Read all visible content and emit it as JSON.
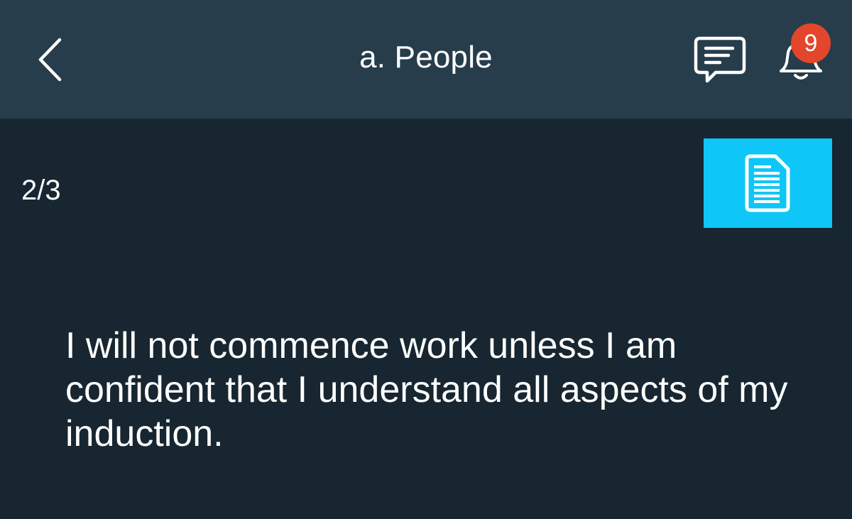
{
  "header": {
    "title": "a. People",
    "back_icon": "chevron-left-icon",
    "chat_icon": "chat-bubble-icon",
    "notification_icon": "bell-icon",
    "notification_count": "9"
  },
  "main": {
    "counter": "2/3",
    "document_icon": "document-icon",
    "statement": "I will not commence work unless I am confident that I understand all aspects of my induction."
  },
  "colors": {
    "header_bg": "#273d4b",
    "body_bg": "#172630",
    "accent": "#0ec6f8",
    "badge": "#e2472c"
  }
}
